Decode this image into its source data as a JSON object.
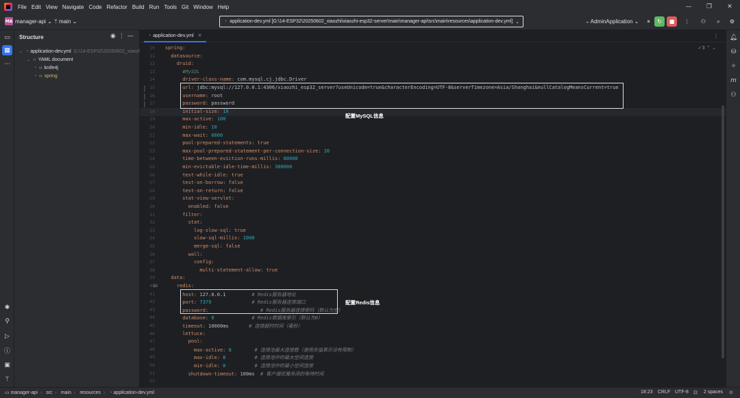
{
  "menu": [
    "File",
    "Edit",
    "View",
    "Navigate",
    "Code",
    "Refactor",
    "Build",
    "Run",
    "Tools",
    "Git",
    "Window",
    "Help"
  ],
  "project": {
    "badge": "MA",
    "name": "manager-api",
    "branch": "main"
  },
  "pathbar": "application-dev.yml [G:\\14-ESP32\\20250602_xiaozhi\\xiaozhi-esp32-server\\main\\manager-api\\src\\main\\resources\\application-dev.yml]",
  "run_config": "AdminApplication",
  "structure": {
    "title": "Structure",
    "root": "application-dev.yml",
    "root_meta": "G:\\14-ESP32\\20250602_xiaozh",
    "doc": "YAML document",
    "children": [
      "knife4j",
      "spring"
    ]
  },
  "editor": {
    "tab": "application-dev.yml",
    "inspection": "3",
    "lines": [
      {
        "n": "10",
        "indent": 0,
        "key": "spring:",
        "val": "",
        "comment": ""
      },
      {
        "n": "11",
        "indent": 1,
        "key": "datasource:",
        "val": "",
        "comment": ""
      },
      {
        "n": "12",
        "indent": 2,
        "key": "druid:",
        "val": "",
        "comment": ""
      },
      {
        "n": "13",
        "indent": 3,
        "key": "",
        "val": "",
        "comment": "#MySQL"
      },
      {
        "n": "14",
        "indent": 3,
        "key": "driver-class-name:",
        "val": " com.mysql.cj.jdbc.Driver",
        "comment": ""
      },
      {
        "n": "15",
        "indent": 3,
        "key": "url:",
        "val": " jdbc:mysql://127.0.0.1:4306/xiaozhi_esp32_server?useUnicode=true&characterEncoding=UTF-8&serverTimezone=Asia/Shanghai&nullCatalogMeansCurrent=true",
        "comment": ""
      },
      {
        "n": "16",
        "indent": 3,
        "key": "username:",
        "val": " root",
        "comment": ""
      },
      {
        "n": "17",
        "indent": 3,
        "key": "password:",
        "val": " password",
        "comment": ""
      },
      {
        "n": "18",
        "indent": 3,
        "key": "initial-size:",
        "num": " 10",
        "comment": ""
      },
      {
        "n": "19",
        "indent": 3,
        "key": "max-active:",
        "num": " 100",
        "comment": ""
      },
      {
        "n": "20",
        "indent": 3,
        "key": "min-idle:",
        "num": " 10",
        "comment": ""
      },
      {
        "n": "21",
        "indent": 3,
        "key": "max-wait:",
        "num": " 6000",
        "comment": ""
      },
      {
        "n": "22",
        "indent": 3,
        "key": "pool-prepared-statements:",
        "kw": " true",
        "comment": ""
      },
      {
        "n": "23",
        "indent": 3,
        "key": "max-pool-prepared-statement-per-connection-size:",
        "num": " 20",
        "comment": ""
      },
      {
        "n": "24",
        "indent": 3,
        "key": "time-between-eviction-runs-millis:",
        "num": " 60000",
        "comment": ""
      },
      {
        "n": "25",
        "indent": 3,
        "key": "min-evictable-idle-time-millis:",
        "num": " 300000",
        "comment": ""
      },
      {
        "n": "26",
        "indent": 3,
        "key": "test-while-idle:",
        "kw": " true",
        "comment": ""
      },
      {
        "n": "27",
        "indent": 3,
        "key": "test-on-borrow:",
        "kw": " false",
        "comment": ""
      },
      {
        "n": "28",
        "indent": 3,
        "key": "test-on-return:",
        "kw": " false",
        "comment": ""
      },
      {
        "n": "29",
        "indent": 3,
        "key": "stat-view-servlet:",
        "val": "",
        "comment": ""
      },
      {
        "n": "30",
        "indent": 4,
        "key": "enabled:",
        "kw": " false",
        "comment": ""
      },
      {
        "n": "31",
        "indent": 3,
        "key": "filter:",
        "val": "",
        "comment": ""
      },
      {
        "n": "32",
        "indent": 4,
        "key": "stat:",
        "val": "",
        "comment": ""
      },
      {
        "n": "33",
        "indent": 5,
        "key": "log-slow-sql:",
        "kw": " true",
        "comment": ""
      },
      {
        "n": "34",
        "indent": 5,
        "key": "slow-sql-millis:",
        "num": " 1000",
        "comment": ""
      },
      {
        "n": "35",
        "indent": 5,
        "key": "merge-sql:",
        "kw": " false",
        "comment": ""
      },
      {
        "n": "36",
        "indent": 4,
        "key": "wall:",
        "val": "",
        "comment": ""
      },
      {
        "n": "37",
        "indent": 5,
        "key": "config:",
        "val": "",
        "comment": ""
      },
      {
        "n": "38",
        "indent": 6,
        "key": "multi-statement-allow:",
        "kw": " true",
        "comment": ""
      },
      {
        "n": "39",
        "indent": 1,
        "key": "data:",
        "val": "",
        "comment": ""
      },
      {
        "n": "40",
        "indent": 2,
        "key": "redis:",
        "val": "",
        "comment": ""
      },
      {
        "n": "41",
        "indent": 3,
        "key": "host:",
        "val": " 127.0.0.1",
        "pad": "         ",
        "comment": "# Redis服务器地址"
      },
      {
        "n": "42",
        "indent": 3,
        "key": "port:",
        "num": " 7379",
        "pad": "              ",
        "comment": "# Redis服务器连接端口"
      },
      {
        "n": "43",
        "indent": 3,
        "key": "password:",
        "val": "",
        "pad": "                  ",
        "comment": "# Redis服务器连接密码（默认为空）"
      },
      {
        "n": "44",
        "indent": 3,
        "key": "database:",
        "num": " 0",
        "pad": "             ",
        "comment": "# Redis数据库索引（默认为0）"
      },
      {
        "n": "45",
        "indent": 3,
        "key": "timeout:",
        "val": " 10000ms",
        "pad": "       ",
        "comment": "# 连接超时时间（毫秒）"
      },
      {
        "n": "46",
        "indent": 3,
        "key": "lettuce:",
        "val": "",
        "comment": ""
      },
      {
        "n": "47",
        "indent": 4,
        "key": "pool:",
        "val": "",
        "comment": ""
      },
      {
        "n": "48",
        "indent": 5,
        "key": "max-active:",
        "num": " 8",
        "pad": "        ",
        "comment": "# 连接池最大连接数（使用负值表示没有限制）"
      },
      {
        "n": "49",
        "indent": 5,
        "key": "max-idle:",
        "num": " 8",
        "pad": "          ",
        "comment": "# 连接池中的最大空闲连接"
      },
      {
        "n": "50",
        "indent": 5,
        "key": "min-idle:",
        "num": " 0",
        "pad": "          ",
        "comment": "# 连接池中的最小空闲连接"
      },
      {
        "n": "51",
        "indent": 4,
        "key": "shutdown-timeout:",
        "val": " 100ms",
        "pad": "  ",
        "comment": "# 客户端优雅关闭的等待时间"
      },
      {
        "n": "52",
        "indent": 0,
        "key": "",
        "val": "",
        "comment": ""
      }
    ],
    "annotations": {
      "mysql": "配置MySQL信息",
      "redis": "配置Redis信息"
    }
  },
  "statusbar": {
    "crumbs": [
      "manager-api",
      "src",
      "main",
      "resources",
      "application-dev.yml"
    ],
    "position": "18:23",
    "line_sep": "CRLF",
    "encoding": "UTF-8",
    "indent": "2 spaces"
  }
}
